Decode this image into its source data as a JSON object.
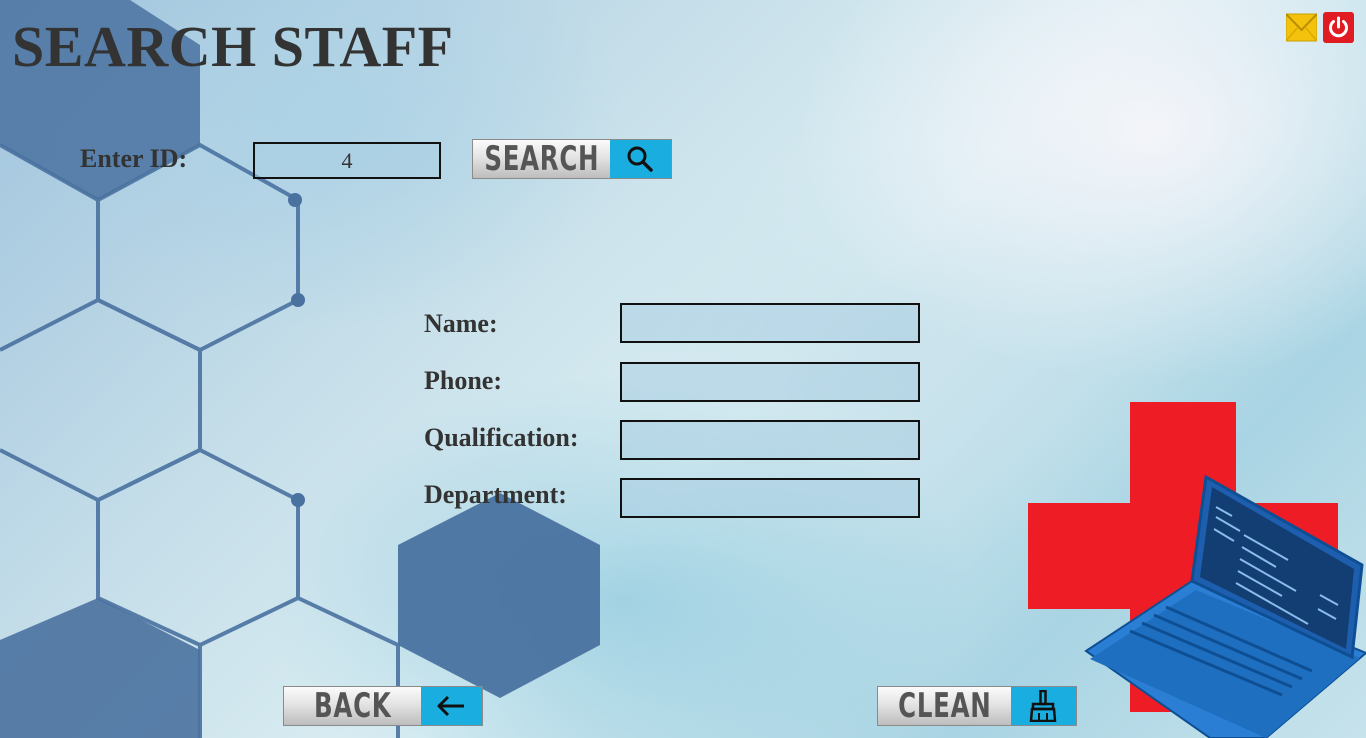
{
  "title": "SEARCH STAFF",
  "search": {
    "label": "Enter ID:",
    "id_value": "4",
    "button_label": "SEARCH",
    "button_icon": "search-icon"
  },
  "fields": {
    "name_label": "Name:",
    "name_value": "",
    "phone_label": "Phone:",
    "phone_value": "",
    "qualification_label": "Qualification:",
    "qualification_value": "",
    "department_label": "Department:",
    "department_value": ""
  },
  "actions": {
    "back_label": "BACK",
    "back_icon": "arrow-left-icon",
    "clean_label": "CLEAN",
    "clean_icon": "broom-icon"
  },
  "top_icons": {
    "mail_icon": "mail-icon",
    "power_icon": "power-icon"
  },
  "colors": {
    "title_text": "#333333",
    "button_accent": "#1aaee0",
    "hex_pattern": "#4a72a0",
    "medical_cross": "#ee1c25",
    "laptop": "#2a7fd4",
    "power_button": "#e01b22",
    "mail_icon": "#f4c20d"
  }
}
